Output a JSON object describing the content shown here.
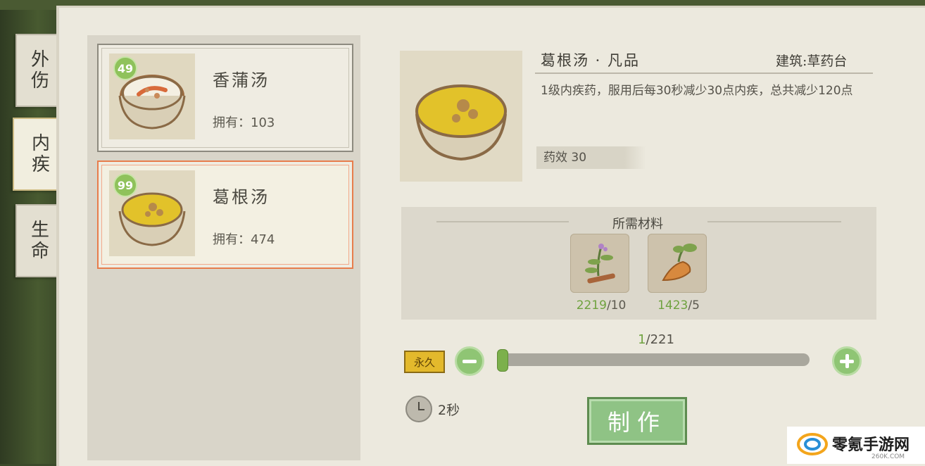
{
  "tabs": [
    {
      "label": "外伤",
      "active": false
    },
    {
      "label": "内疾",
      "active": true
    },
    {
      "label": "生命",
      "active": false
    }
  ],
  "recipes": [
    {
      "badge": "49",
      "name": "香蒲汤",
      "owned_label": "拥有：103",
      "selected": false,
      "icon": "cattail-soup-bowl-icon"
    },
    {
      "badge": "99",
      "name": "葛根汤",
      "owned_label": "拥有：474",
      "selected": true,
      "icon": "kudzu-soup-bowl-icon"
    }
  ],
  "detail": {
    "title": "葛根汤 · 凡品",
    "building": "建筑:草药台",
    "description": "1级内疾药，服用后每30秒减少30点内疾，总共减少120点",
    "potency": "药效 30",
    "icon": "kudzu-soup-bowl-icon"
  },
  "materials": {
    "title": "所需材料",
    "items": [
      {
        "icon": "herb-branch-icon",
        "have": "2219",
        "need": "/10"
      },
      {
        "icon": "kudzu-root-icon",
        "have": "1423",
        "need": "/5"
      }
    ]
  },
  "quantity": {
    "current": "1",
    "max_label": "/221",
    "fraction": 0.0045
  },
  "permanent_badge": "永久",
  "time": "2秒",
  "make_button": "制作",
  "watermark": {
    "text": "零氪手游网",
    "sub": "260K.COM"
  },
  "colors": {
    "accent_green": "#6fa23f",
    "selected_border": "#e77d4c",
    "badge_gold": "#e3b92c"
  }
}
